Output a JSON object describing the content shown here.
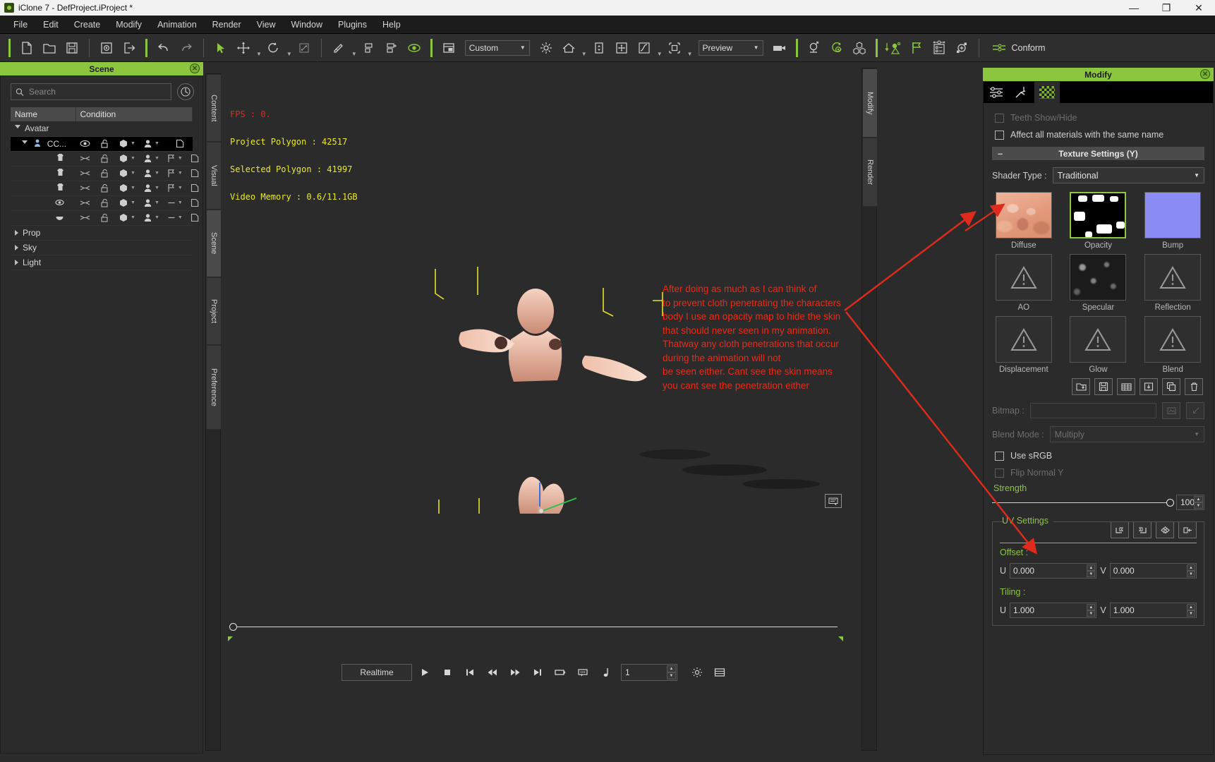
{
  "window": {
    "title": "iClone 7 - DefProject.iProject *",
    "minimize": "—",
    "maximize": "❐",
    "close": "✕"
  },
  "menu": [
    "File",
    "Edit",
    "Create",
    "Modify",
    "Animation",
    "Render",
    "View",
    "Window",
    "Plugins",
    "Help"
  ],
  "toolbar": {
    "view_preset": "Custom",
    "render_mode": "Preview",
    "conform_label": "Conform",
    "icons": [
      "new-file-icon",
      "open-folder-icon",
      "save-icon",
      "load-preset-icon",
      "export-icon",
      "undo-icon",
      "redo-icon",
      "select-tool-icon",
      "move-tool-icon",
      "rotate-tool-icon",
      "scale-tool-icon",
      "paint-tool-icon",
      "align-icon",
      "align-extra-icon",
      "eye-icon",
      "layout-icon",
      "light-icon",
      "home-icon",
      "dock-icon",
      "fit-icon",
      "curve-icon",
      "bbox-icon",
      "camera-icon",
      "persona-icon",
      "motion-icon",
      "props-icon",
      "drop-to-floor-icon",
      "flag-icon",
      "list-icon",
      "attach-icon"
    ]
  },
  "scene": {
    "panel_title": "Scene",
    "search_placeholder": "Search",
    "columns": [
      "Name",
      "Condition"
    ],
    "rows": [
      {
        "name": "Avatar",
        "type": "group",
        "expanded": true,
        "indent": 0,
        "icons": []
      },
      {
        "name": "CC...",
        "type": "avatar",
        "expanded": true,
        "indent": 1,
        "selected": true,
        "icons": [
          "eye-icon",
          "lock-icon",
          "cube-icon",
          "person-icon",
          "page-icon"
        ]
      },
      {
        "name": "",
        "type": "cloth",
        "indent": 2,
        "icons": [
          "eye-off-icon",
          "lock-icon",
          "cube-icon",
          "person-icon",
          "flag-icon",
          "page-icon"
        ]
      },
      {
        "name": "",
        "type": "cloth",
        "indent": 2,
        "icons": [
          "eye-off-icon",
          "lock-icon",
          "cube-icon",
          "person-icon",
          "flag-icon",
          "page-icon"
        ]
      },
      {
        "name": "",
        "type": "cloth",
        "indent": 2,
        "icons": [
          "eye-off-icon",
          "lock-icon",
          "cube-icon",
          "person-icon",
          "flag-icon",
          "page-icon"
        ]
      },
      {
        "name": "",
        "type": "eye",
        "indent": 2,
        "icons": [
          "eye-off-icon",
          "lock-icon",
          "cube-icon",
          "person-icon",
          "dash-icon",
          "page-icon"
        ]
      },
      {
        "name": "",
        "type": "mouth",
        "indent": 2,
        "icons": [
          "eye-off-icon",
          "lock-icon",
          "cube-icon",
          "person-icon",
          "dash-icon",
          "page-icon"
        ]
      },
      {
        "name": "Prop",
        "type": "group",
        "expanded": false,
        "indent": 0,
        "icons": []
      },
      {
        "name": "Sky",
        "type": "group",
        "expanded": false,
        "indent": 0,
        "icons": []
      },
      {
        "name": "Light",
        "type": "group",
        "expanded": false,
        "indent": 0,
        "icons": []
      }
    ]
  },
  "left_rail": [
    "Content",
    "Visual",
    "Scene",
    "Project",
    "Preference"
  ],
  "right_rail": [
    "Modify",
    "Render"
  ],
  "viewport": {
    "stats": {
      "fps": "FPS : 0.",
      "project_polygon": "Project Polygon : 42517",
      "selected_polygon": "Selected Polygon : 41997",
      "video_memory": "Video Memory : 0.6/11.1GB"
    },
    "annotation": "After doing as much as I can think of to prevent cloth penetrating the characters body I use an opacity map to hide the skin that should never seen in my animation. Thatway any cloth penetrations that occur during the animation will not\nbe seen either. Cant see the skin means you cant see the penetration either",
    "annotation_lines": [
      "After doing as much as I can think of",
      "to prevent cloth penetrating the characters",
      "body I use an opacity map to hide the skin",
      "that should never seen in my animation.",
      "Thatway any cloth penetrations that occur",
      "during the animation will not",
      "be seen either. Cant see the skin means",
      "you cant see the penetration either"
    ],
    "note_icon": "comment-icon"
  },
  "transport": {
    "mode": "Realtime",
    "frame_value": "1",
    "buttons": [
      "play-button",
      "stop-button",
      "go-to-start-button",
      "step-back-button",
      "step-forward-button",
      "go-to-end-button",
      "loop-button",
      "caption-button",
      "audio-button"
    ],
    "extra": [
      "settings-gear-icon",
      "timeline-icon"
    ]
  },
  "modify": {
    "panel_title": "Modify",
    "tabs": [
      "attribute-tab",
      "motion-tab",
      "material-tab"
    ],
    "active_tab": 2,
    "teeth_show_hide": "Teeth Show/Hide",
    "affect_all": "Affect all materials with the same name",
    "texture_settings": "Texture Settings (Y)",
    "shader_type_label": "Shader Type :",
    "shader_type_value": "Traditional",
    "textures": [
      {
        "label": "Diffuse",
        "kind": "skin",
        "selected": false
      },
      {
        "label": "Opacity",
        "kind": "opacity",
        "selected": true
      },
      {
        "label": "Bump",
        "kind": "bump",
        "selected": false
      },
      {
        "label": "AO",
        "kind": "empty",
        "selected": false
      },
      {
        "label": "Specular",
        "kind": "noise",
        "selected": false
      },
      {
        "label": "Reflection",
        "kind": "empty",
        "selected": false
      },
      {
        "label": "Displacement",
        "kind": "empty",
        "selected": false
      },
      {
        "label": "Glow",
        "kind": "empty",
        "selected": false
      },
      {
        "label": "Blend",
        "kind": "empty",
        "selected": false
      }
    ],
    "action_icons": [
      "load-texture-icon",
      "save-texture-icon",
      "uv-grid-icon",
      "import-icon",
      "copy-icon",
      "delete-icon"
    ],
    "bitmap_label": "Bitmap :",
    "bitmap_value": "",
    "blend_mode_label": "Blend Mode :",
    "blend_mode_value": "Multiply",
    "use_srgb": "Use sRGB",
    "flip_normal_y": "Flip Normal Y",
    "strength_label": "Strength",
    "strength_value": "100",
    "uv_settings_title": "UV Settings",
    "uv_buttons": [
      "rotate-uv-icon",
      "flip-uv-icon",
      "mirror-v-icon",
      "mirror-h-icon"
    ],
    "offset_label": "Offset :",
    "offset_u_label": "U",
    "offset_u": "0.000",
    "offset_v_label": "V",
    "offset_v": "0.000",
    "tiling_label": "Tiling :",
    "tiling_u_label": "U",
    "tiling_u": "1.000",
    "tiling_v_label": "V",
    "tiling_v": "1.000"
  },
  "colors": {
    "accent": "#8cc63f",
    "annotation_red": "#ed2a16",
    "stats_yellow": "#e8e82a",
    "panel_bg": "#2b2b2b"
  }
}
